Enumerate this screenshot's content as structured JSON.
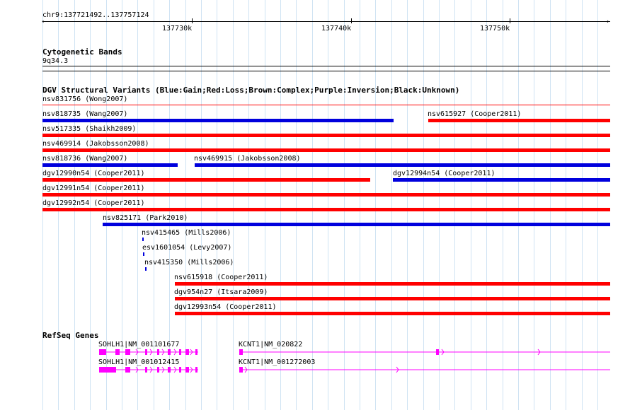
{
  "ruler": {
    "location": "chr9:137721492..137757124",
    "ticks": [
      "137730k",
      "137740k",
      "137750k"
    ]
  },
  "tracks": {
    "cytoband": {
      "title": "Cytogenetic Bands",
      "band": "9q34.3"
    },
    "dgv": {
      "title": "DGV Structural Variants (Blue:Gain;Red:Loss;Brown:Complex;Purple:Inversion;Black:Unknown)"
    },
    "refseq": {
      "title": "RefSeq Genes"
    }
  },
  "colors": {
    "gain": "#0000dd",
    "loss": "#ff0000",
    "gene": "#ff00ff",
    "grid": "#cfe3f3"
  },
  "variants": [
    {
      "label": "nsv831756 (Wong2007)",
      "type": "loss"
    },
    {
      "label": "nsv818735 (Wang2007)",
      "type": "gain"
    },
    {
      "label": "nsv615927 (Cooper2011)",
      "type": "loss"
    },
    {
      "label": "nsv517335 (Shaikh2009)",
      "type": "loss"
    },
    {
      "label": "nsv469914 (Jakobsson2008)",
      "type": "loss"
    },
    {
      "label": "nsv818736 (Wang2007)",
      "type": "gain"
    },
    {
      "label": "nsv469915 (Jakobsson2008)",
      "type": "gain"
    },
    {
      "label": "dgv12990n54 (Cooper2011)",
      "type": "loss"
    },
    {
      "label": "dgv12994n54 (Cooper2011)",
      "type": "gain"
    },
    {
      "label": "dgv12991n54 (Cooper2011)",
      "type": "loss"
    },
    {
      "label": "dgv12992n54 (Cooper2011)",
      "type": "loss"
    },
    {
      "label": "nsv825171 (Park2010)",
      "type": "gain"
    },
    {
      "label": "nsv415465 (Mills2006)",
      "type": "gain"
    },
    {
      "label": "esv1601054 (Levy2007)",
      "type": "gain"
    },
    {
      "label": "nsv415350 (Mills2006)",
      "type": "gain"
    },
    {
      "label": "nsv615918 (Cooper2011)",
      "type": "loss"
    },
    {
      "label": "dgv954n27 (Itsara2009)",
      "type": "loss"
    },
    {
      "label": "dgv12993n54 (Cooper2011)",
      "type": "loss"
    }
  ],
  "genes": [
    {
      "label": "SOHLH1|NM_001101677",
      "strand": "-"
    },
    {
      "label": "SOHLH1|NM_001012415",
      "strand": "-"
    },
    {
      "label": "KCNT1|NM_020822",
      "strand": "+"
    },
    {
      "label": "KCNT1|NM_001272003",
      "strand": "+"
    }
  ]
}
